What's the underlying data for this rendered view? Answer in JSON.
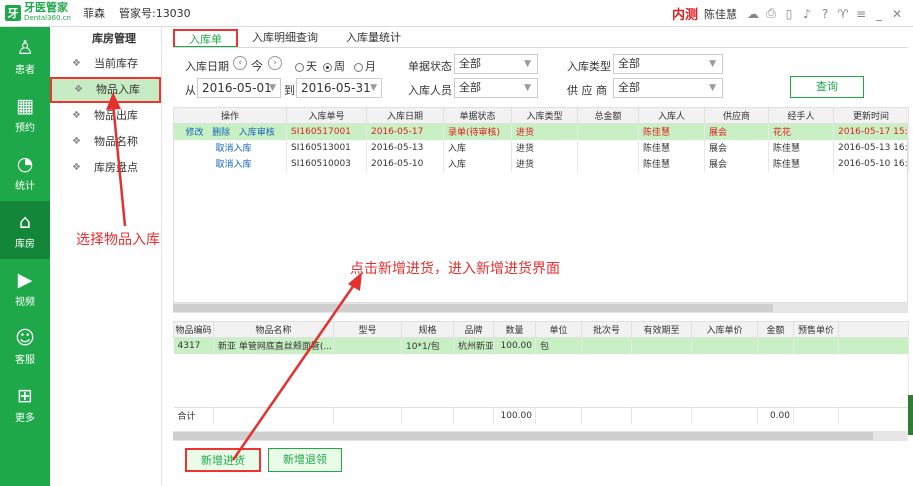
{
  "titlebar": {
    "brand": "牙医管家",
    "brand_sub": "Dental360.cn",
    "user": "菲森",
    "account": "管家号:13030",
    "env": "内测",
    "operator": "陈佳慧"
  },
  "leftnav": [
    {
      "label": "患者",
      "icon": "person-icon",
      "glyph": "♙"
    },
    {
      "label": "预约",
      "icon": "calendar-icon",
      "glyph": "▦"
    },
    {
      "label": "统计",
      "icon": "pie-chart-icon",
      "glyph": "◔"
    },
    {
      "label": "库房",
      "icon": "warehouse-icon",
      "glyph": "⌂"
    },
    {
      "label": "视频",
      "icon": "play-icon",
      "glyph": "▶"
    },
    {
      "label": "客服",
      "icon": "smile-icon",
      "glyph": "☺"
    },
    {
      "label": "更多",
      "icon": "grid-icon",
      "glyph": "⊞"
    }
  ],
  "subnav": {
    "title": "库房管理",
    "items": [
      "当前库存",
      "物品入库",
      "物品出库",
      "物品名称",
      "库房盘点"
    ]
  },
  "tabs": [
    "入库单",
    "入库明细查询",
    "入库量统计"
  ],
  "filters": {
    "date_label": "入库日期",
    "today": "今",
    "day": "天",
    "week": "周",
    "month": "月",
    "from_label": "从",
    "from_date": "2016-05-01",
    "to_label": "到",
    "to_date": "2016-05-31",
    "status_label": "单据状态",
    "status_value": "全部",
    "person_label": "入库人员",
    "person_value": "全部",
    "type_label": "入库类型",
    "type_value": "全部",
    "supplier_label": "供 应 商",
    "supplier_value": "全部",
    "query": "查询"
  },
  "grid1": {
    "headers": [
      "操作",
      "入库单号",
      "入库日期",
      "单据状态",
      "入库类型",
      "总金额",
      "入库人",
      "供应商",
      "经手人",
      "更新时间"
    ],
    "rows": [
      {
        "ops": [
          "修改",
          "删除",
          "入库审核"
        ],
        "no": "SI160517001",
        "date": "2016-05-17",
        "status": "录单(待审核)",
        "type": "进货",
        "amount": "",
        "person": "陈佳慧",
        "supplier": "展会",
        "handler": "花花",
        "updated": "2016-05-17 15:.."
      },
      {
        "ops": [
          "取消入库"
        ],
        "no": "SI160513001",
        "date": "2016-05-13",
        "status": "入库",
        "type": "进货",
        "amount": "",
        "person": "陈佳慧",
        "supplier": "展会",
        "handler": "陈佳慧",
        "updated": "2016-05-13 16:.."
      },
      {
        "ops": [
          "取消入库"
        ],
        "no": "SI160510003",
        "date": "2016-05-10",
        "status": "入库",
        "type": "进货",
        "amount": "",
        "person": "陈佳慧",
        "supplier": "展会",
        "handler": "陈佳慧",
        "updated": "2016-05-10 16:.."
      }
    ]
  },
  "grid2": {
    "headers": [
      "物品编码",
      "物品名称",
      "型号",
      "规格",
      "品牌",
      "数量",
      "单位",
      "批次号",
      "有效期至",
      "入库单价",
      "金额",
      "预售单价"
    ],
    "rows": [
      {
        "code": "4317",
        "name": "新亚 单管网底直丝颊面管(...",
        "model": "",
        "spec": "10*1/包",
        "brand": "杭州新亚",
        "qty": "100.00",
        "unit": "包",
        "batch": "",
        "expiry": "",
        "price": "",
        "amount": "",
        "presale": ""
      }
    ],
    "total_label": "合计",
    "total_qty": "100.00",
    "total_amount": "0.00"
  },
  "buttons": {
    "new_stock": "新增进货",
    "new_return": "新增退领"
  },
  "annotations": {
    "select_item_in": "选择物品入库",
    "click_new": "点击新增进货，进入新增进货界面"
  }
}
